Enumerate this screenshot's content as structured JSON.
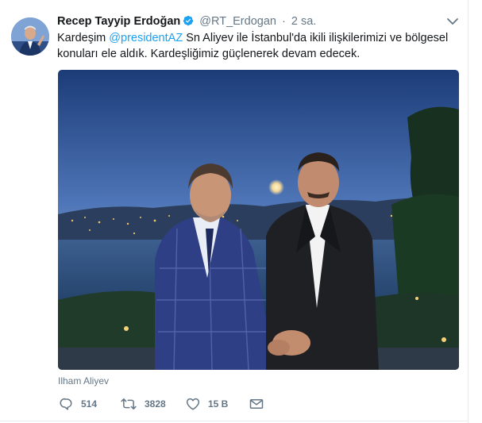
{
  "tweet": {
    "fullname": "Recep Tayyip Erdoğan",
    "screen_name": "@RT_Erdogan",
    "separator": "·",
    "timestamp": "2 sa.",
    "text_before": "Kardeşim ",
    "mention": "@presidentAZ",
    "text_after": " Sn Aliyev ile İstanbul'da ikili ilişkilerimizi ve bölgesel konuları ele aldık. Kardeşliğimiz güçlenerek devam edecek.",
    "photo_tag": "Ilham Aliyev"
  },
  "actions": {
    "reply_count": "514",
    "retweet_count": "3828",
    "like_count": "15 B"
  },
  "icons": {
    "verified": "verified-badge-icon",
    "caret": "chevron-down-icon",
    "reply": "reply-icon",
    "retweet": "retweet-icon",
    "like": "heart-icon",
    "dm": "envelope-icon"
  },
  "colors": {
    "link": "#1da1f2",
    "secondary_text": "#657786",
    "primary_text": "#14171a",
    "verified": "#1da1f2"
  }
}
